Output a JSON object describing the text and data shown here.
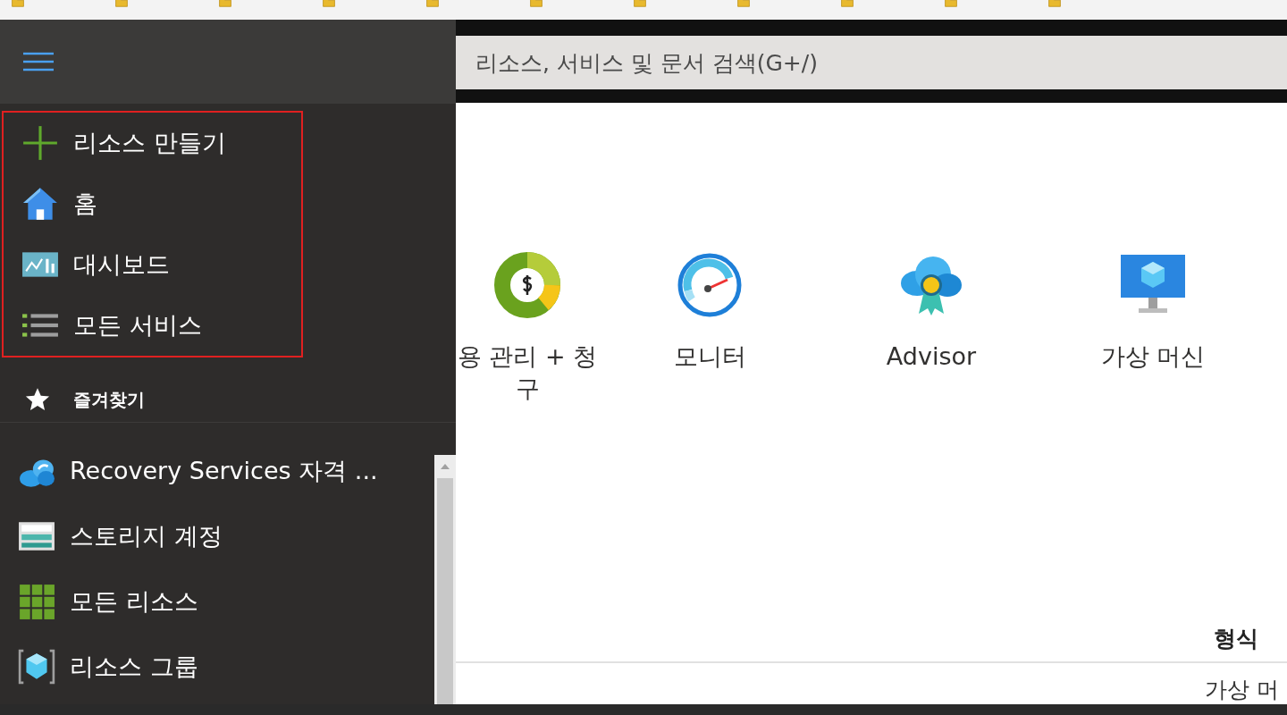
{
  "sidebar": {
    "main_items": [
      {
        "label": "리소스 만들기"
      },
      {
        "label": "홈"
      },
      {
        "label": "대시보드"
      },
      {
        "label": "모든 서비스"
      }
    ],
    "favorites": {
      "title": "즐겨찾기",
      "items": [
        {
          "label": "Recovery Services 자격 ..."
        },
        {
          "label": "스토리지 계정"
        },
        {
          "label": "모든 리소스"
        },
        {
          "label": "리소스 그룹"
        }
      ]
    }
  },
  "search": {
    "placeholder": "리소스, 서비스 및 문서 검색(G+/)"
  },
  "services": [
    {
      "label": "용 관리 + 청구"
    },
    {
      "label": "모니터"
    },
    {
      "label": "Advisor"
    },
    {
      "label": "가상 머신"
    }
  ],
  "table": {
    "columns": [
      "형식"
    ],
    "rows": [
      [
        "가상 머"
      ]
    ]
  }
}
